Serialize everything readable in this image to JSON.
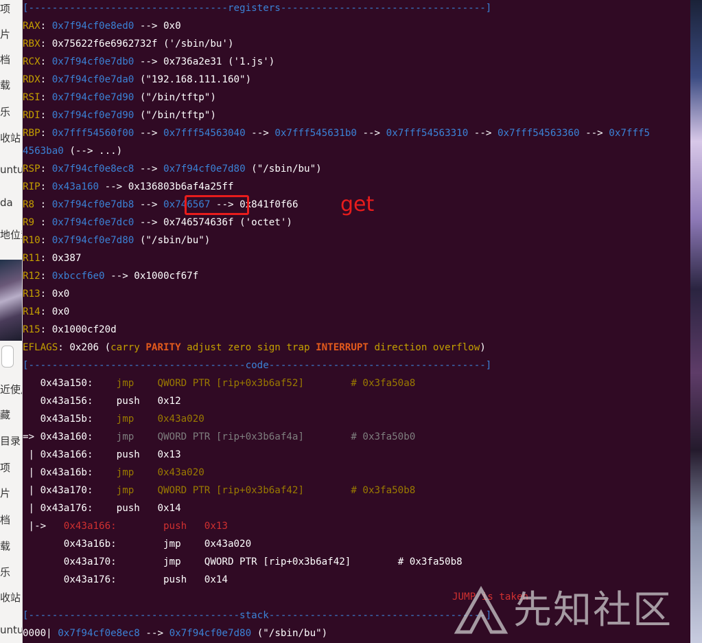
{
  "sidebar": {
    "items": [
      "项",
      "片",
      "档",
      "载",
      "乐",
      "收站",
      "untu",
      "da",
      "地位置",
      "近使用",
      "藏",
      "目录",
      "项",
      "片",
      "档",
      "载",
      "乐",
      "收站",
      "untu"
    ]
  },
  "registers": {
    "header": "[----------------------------------registers-----------------------------------]",
    "rows": [
      {
        "name": "RAX",
        "sep": ": ",
        "addr": "0x7f94cf0e8ed0",
        "rest": " --> 0x0"
      },
      {
        "name": "RBX",
        "sep": ": ",
        "addr": "",
        "rest": "0x75622f6e6962732f ('/sbin/bu')"
      },
      {
        "name": "RCX",
        "sep": ": ",
        "addr": "0x7f94cf0e7db0",
        "rest": " --> 0x736a2e31 ('1.js')"
      },
      {
        "name": "RDX",
        "sep": ": ",
        "addr": "0x7f94cf0e7da0",
        "rest": " (\"192.168.111.160\")"
      },
      {
        "name": "RSI",
        "sep": ": ",
        "addr": "0x7f94cf0e7d90",
        "rest": " (\"/bin/tftp\")"
      },
      {
        "name": "RDI",
        "sep": ": ",
        "addr": "0x7f94cf0e7d90",
        "rest": " (\"/bin/tftp\")"
      }
    ],
    "rbp": {
      "name": "RBP",
      "chain": [
        "0x7fff54560f00",
        "0x7fff54563040",
        "0x7fff545631b0",
        "0x7fff54563310",
        "0x7fff54563360",
        "0x7fff5"
      ],
      "wrap": "4563ba0",
      "wrap_rest": " (--> ...)"
    },
    "rsp": {
      "name": "RSP",
      "addr": "0x7f94cf0e8ec8",
      "addr2": "0x7f94cf0e7d80",
      "rest": " (\"/sbin/bu\")"
    },
    "rip": {
      "name": "RIP",
      "addr": "0x43a160",
      "rest": " --> 0x136803b6af4a25ff"
    },
    "r8": {
      "name": "R8 ",
      "addr": "0x7f94cf0e7db8",
      "hl": "0x746567",
      "rest": " --> 0x841f0f66"
    },
    "r9": {
      "name": "R9 ",
      "addr": "0x7f94cf0e7dc0",
      "rest": " --> 0x746574636f ('octet')"
    },
    "r10": {
      "name": "R10",
      "addr": "0x7f94cf0e7d80",
      "rest": " (\"/sbin/bu\")"
    },
    "r11": {
      "name": "R11",
      "rest": "0x387"
    },
    "r12": {
      "name": "R12",
      "addr": "0xbccf6e0",
      "rest": " --> 0x1000cf67f"
    },
    "r13": {
      "name": "R13",
      "rest": "0x0"
    },
    "r14": {
      "name": "R14",
      "rest": "0x0"
    },
    "r15": {
      "name": "R15",
      "rest": "0x1000cf20d"
    },
    "eflags": {
      "name": "EFLAGS",
      "value": ": 0x206 (",
      "carry": "carry ",
      "parity": "PARITY",
      "mid": " adjust zero sign trap ",
      "interrupt": "INTERRUPT",
      "tail": " direction overflow",
      "close": ")"
    }
  },
  "annotation": {
    "label": "get"
  },
  "code": {
    "header": "[-------------------------------------code-------------------------------------]",
    "lines": [
      {
        "prefix": "   ",
        "addr": "0x43a150:",
        "gap": "    ",
        "op": "jmp   ",
        "args": " QWORD PTR [rip+0x3b6af52]",
        "cmt": "        # 0x3fa50a8",
        "style": "dim"
      },
      {
        "prefix": "   ",
        "addr": "0x43a156:",
        "gap": "    ",
        "op": "push  ",
        "args": " 0x12",
        "cmt": "",
        "style": "plain"
      },
      {
        "prefix": "   ",
        "addr": "0x43a15b:",
        "gap": "    ",
        "op": "jmp   ",
        "args": " 0x43a020",
        "cmt": "",
        "style": "dimy"
      },
      {
        "prefix": "=> ",
        "addr": "0x43a160:",
        "gap": "    ",
        "op": "jmp   ",
        "args": " QWORD PTR [rip+0x3b6af4a]",
        "cmt": "        # 0x3fa50b0",
        "style": "cur"
      },
      {
        "prefix": " | ",
        "addr": "0x43a166:",
        "gap": "    ",
        "op": "push  ",
        "args": " 0x13",
        "cmt": "",
        "style": "plain"
      },
      {
        "prefix": " | ",
        "addr": "0x43a16b:",
        "gap": "    ",
        "op": "jmp   ",
        "args": " 0x43a020",
        "cmt": "",
        "style": "dimy"
      },
      {
        "prefix": " | ",
        "addr": "0x43a170:",
        "gap": "    ",
        "op": "jmp   ",
        "args": " QWORD PTR [rip+0x3b6af42]",
        "cmt": "        # 0x3fa50b8",
        "style": "dim"
      },
      {
        "prefix": " | ",
        "addr": "0x43a176:",
        "gap": "    ",
        "op": "push  ",
        "args": " 0x14",
        "cmt": "",
        "style": "plain"
      }
    ],
    "target_lines": [
      {
        "prefix": " |->   ",
        "addr": "0x43a166:",
        "gap": "        ",
        "op": "push  ",
        "args": " 0x13",
        "cmt": "",
        "style": "red"
      },
      {
        "prefix": "       ",
        "addr": "0x43a16b:",
        "gap": "        ",
        "op": "jmp   ",
        "args": " 0x43a020",
        "cmt": "",
        "style": "plain"
      },
      {
        "prefix": "       ",
        "addr": "0x43a170:",
        "gap": "        ",
        "op": "jmp   ",
        "args": " QWORD PTR [rip+0x3b6af42]",
        "cmt": "        # 0x3fa50b8",
        "style": "plain"
      },
      {
        "prefix": "       ",
        "addr": "0x43a176:",
        "gap": "        ",
        "op": "push  ",
        "args": " 0x14",
        "cmt": "",
        "style": "plain"
      }
    ],
    "jump_status": "JUMP is taken"
  },
  "stack": {
    "header": "[------------------------------------stack-------------------------------------]",
    "rows": [
      {
        "idx": "0000| ",
        "addr": "0x7f94cf0e8ec8",
        "arrow": " --> ",
        "addr2": "0x7f94cf0e7d80",
        "rest": " (\"/sbin/bu\")"
      }
    ]
  },
  "watermark": {
    "text": "先知社区"
  },
  "colors": {
    "background": "#300a24",
    "reg_name": "#c4a000",
    "address": "#3b82d6",
    "annotation": "#e81c1c"
  }
}
